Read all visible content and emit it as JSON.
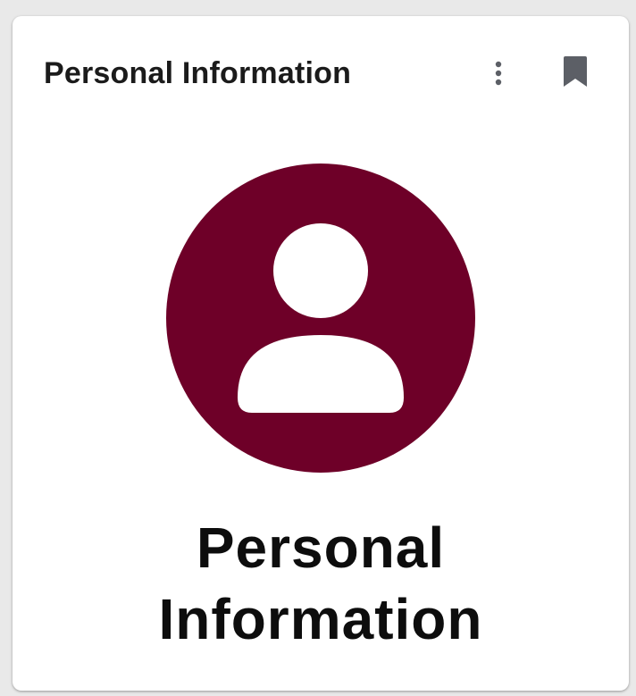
{
  "card": {
    "header_title": "Personal Information",
    "label_line1": "Personal",
    "label_line2": "Information"
  },
  "icons": {
    "menu": "more-vert-icon",
    "bookmark": "bookmark-icon",
    "avatar": "person-avatar-icon"
  },
  "colors": {
    "accent": "#6e0028",
    "icon_gray": "#5c5f66",
    "text": "#1b1b1b"
  }
}
